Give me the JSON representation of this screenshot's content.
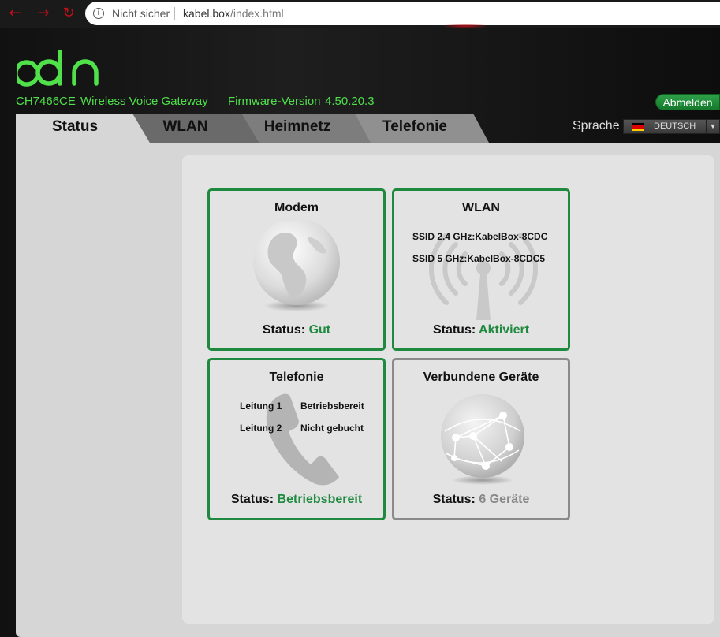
{
  "browser": {
    "security_label": "Nicht sicher",
    "url_host": "kabel.box",
    "url_path": "/index.html"
  },
  "header": {
    "model": "CH7466CE",
    "product": "Wireless Voice Gateway",
    "firmware_label": "Firmware-Version",
    "firmware_version": "4.50.20.3",
    "logout_label": "Abmelden"
  },
  "tabs": [
    {
      "label": "Status",
      "active": true
    },
    {
      "label": "WLAN",
      "active": false
    },
    {
      "label": "Heimnetz",
      "active": false
    },
    {
      "label": "Telefonie",
      "active": false
    }
  ],
  "language": {
    "label": "Sprache",
    "selected": "DEUTSCH"
  },
  "cards": {
    "modem": {
      "title": "Modem",
      "status_label": "Status:",
      "status_value": "Gut"
    },
    "wlan": {
      "title": "WLAN",
      "ssid_24": "SSID 2.4 GHz:KabelBox-8CDC",
      "ssid_5": "SSID 5 GHz:KabelBox-8CDC5",
      "status_label": "Status:",
      "status_value": "Aktiviert"
    },
    "telefonie": {
      "title": "Telefonie",
      "lines": [
        {
          "name": "Leitung 1",
          "state": "Betriebsbereit"
        },
        {
          "name": "Leitung 2",
          "state": "Nicht gebucht"
        }
      ],
      "status_label": "Status:",
      "status_value": "Betriebsbereit"
    },
    "devices": {
      "title": "Verbundene Geräte",
      "status_label": "Status:",
      "status_value": "6 Geräte"
    }
  },
  "colors": {
    "accent_green": "#1f8a3f",
    "logo_green": "#4fe04a",
    "browser_nav_red": "#c0101a"
  }
}
